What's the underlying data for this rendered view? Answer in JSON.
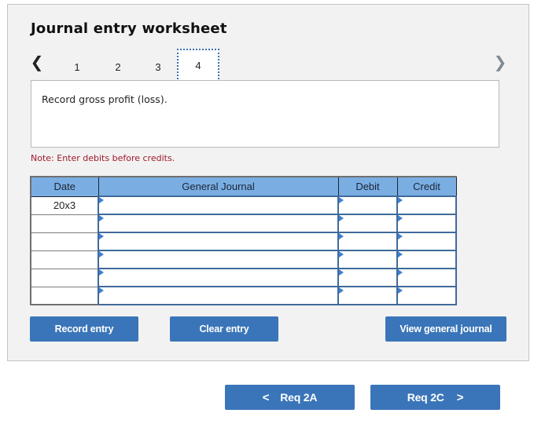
{
  "worksheet": {
    "title": "Journal entry worksheet",
    "nav": {
      "prev_icon": "chevron-left-icon",
      "next_icon": "chevron-right-icon",
      "prev_glyph": "❮",
      "next_glyph": "❯",
      "steps": [
        "1",
        "2",
        "3",
        "4"
      ],
      "active_step": "4"
    },
    "instruction": "Record gross profit (loss).",
    "note": "Note: Enter debits before credits."
  },
  "journal_table": {
    "headers": {
      "date": "Date",
      "general_journal": "General Journal",
      "debit": "Debit",
      "credit": "Credit"
    },
    "rows": [
      {
        "date": "20x3",
        "account": "",
        "debit": "",
        "credit": ""
      },
      {
        "date": "",
        "account": "",
        "debit": "",
        "credit": ""
      },
      {
        "date": "",
        "account": "",
        "debit": "",
        "credit": ""
      },
      {
        "date": "",
        "account": "",
        "debit": "",
        "credit": ""
      },
      {
        "date": "",
        "account": "",
        "debit": "",
        "credit": ""
      },
      {
        "date": "",
        "account": "",
        "debit": "",
        "credit": ""
      }
    ]
  },
  "buttons": {
    "record_entry": "Record entry",
    "clear_entry": "Clear entry",
    "view_general_journal": "View general journal",
    "req_prev": "Req 2A",
    "req_next": "Req 2C",
    "req_prev_glyph": "<",
    "req_next_glyph": ">"
  },
  "colors": {
    "button_blue": "#3a75b9",
    "header_blue": "#7aaee3",
    "note_red": "#a0192b",
    "panel_bg": "#f2f2f2"
  }
}
